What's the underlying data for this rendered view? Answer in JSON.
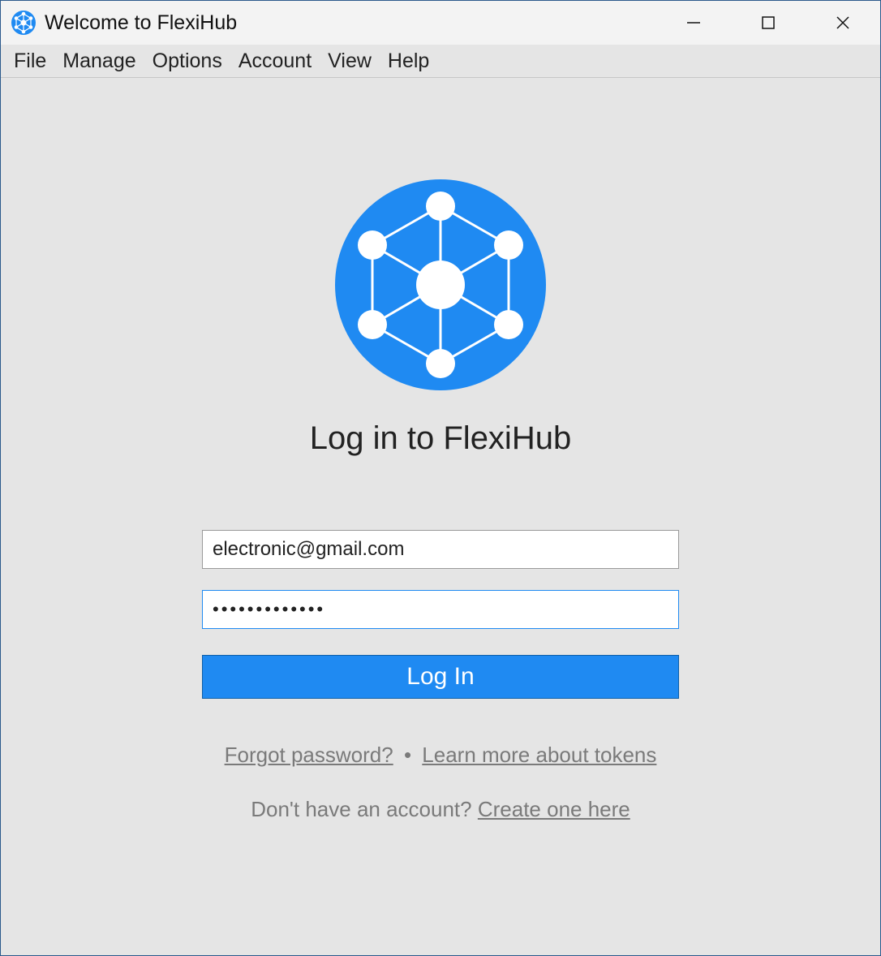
{
  "titlebar": {
    "title": "Welcome to FlexiHub"
  },
  "menu": {
    "items": [
      "File",
      "Manage",
      "Options",
      "Account",
      "View",
      "Help"
    ]
  },
  "main": {
    "heading": "Log in to FlexiHub",
    "email_value": "electronic@gmail.com",
    "password_mask": "●●●●●●●●●●●●●",
    "login_button": "Log In",
    "forgot_password": "Forgot password?",
    "separator": "•",
    "learn_tokens": "Learn more about tokens",
    "no_account_text": "Don't have an account? ",
    "create_one": "Create one here"
  },
  "colors": {
    "accent": "#1f8af2"
  }
}
